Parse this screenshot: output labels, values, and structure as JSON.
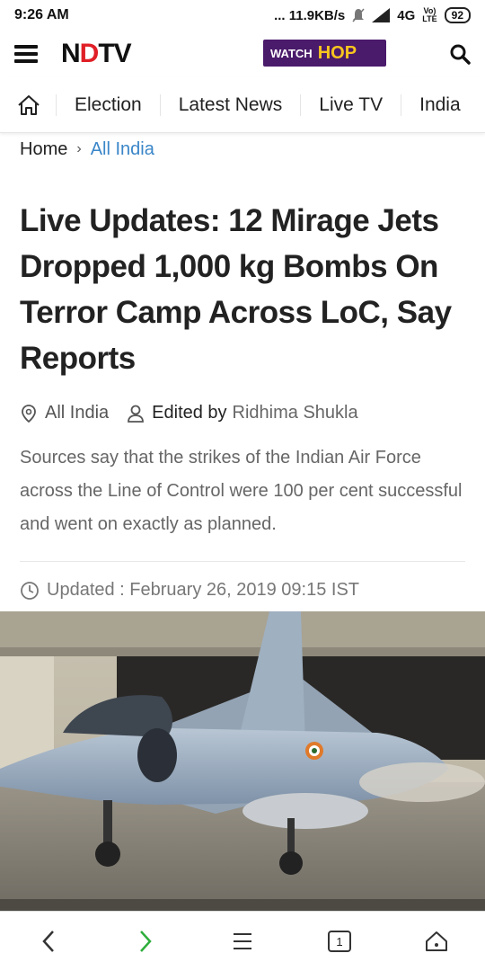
{
  "status_bar": {
    "time": "9:26 AM",
    "speed": "... 11.9KB/s",
    "network": "4G",
    "volte_top": "Vo)",
    "volte_bottom": "LTE",
    "battery": "92"
  },
  "header": {
    "logo_prefix": "N",
    "logo_red": "D",
    "logo_suffix": "TV",
    "watch_label": "WATCH",
    "hop_label": "HOP"
  },
  "nav": {
    "items": [
      "Election",
      "Latest News",
      "Live TV",
      "India"
    ]
  },
  "breadcrumb": {
    "home": "Home",
    "separator": "›",
    "current": "All India"
  },
  "article": {
    "headline": "Live Updates: 12 Mirage Jets Dropped 1,000 kg Bombs On Terror Camp Across LoC, Say Reports",
    "location": "All India",
    "edited_by_label": "Edited by",
    "author": "Ridhima Shukla",
    "summary": "Sources say that the strikes of the Indian Air Force across the Line of Control were 100 per cent successful and went on exactly as planned.",
    "updated": "Updated : February 26, 2019 09:15 IST"
  },
  "bottom_bar": {
    "tab_count": "1"
  },
  "colors": {
    "accent_red": "#e01f26",
    "watch_bg": "#4a1a6b",
    "hop_yellow": "#f7c51e",
    "link_blue": "#3a86c8",
    "forward_green": "#2eae3b"
  }
}
